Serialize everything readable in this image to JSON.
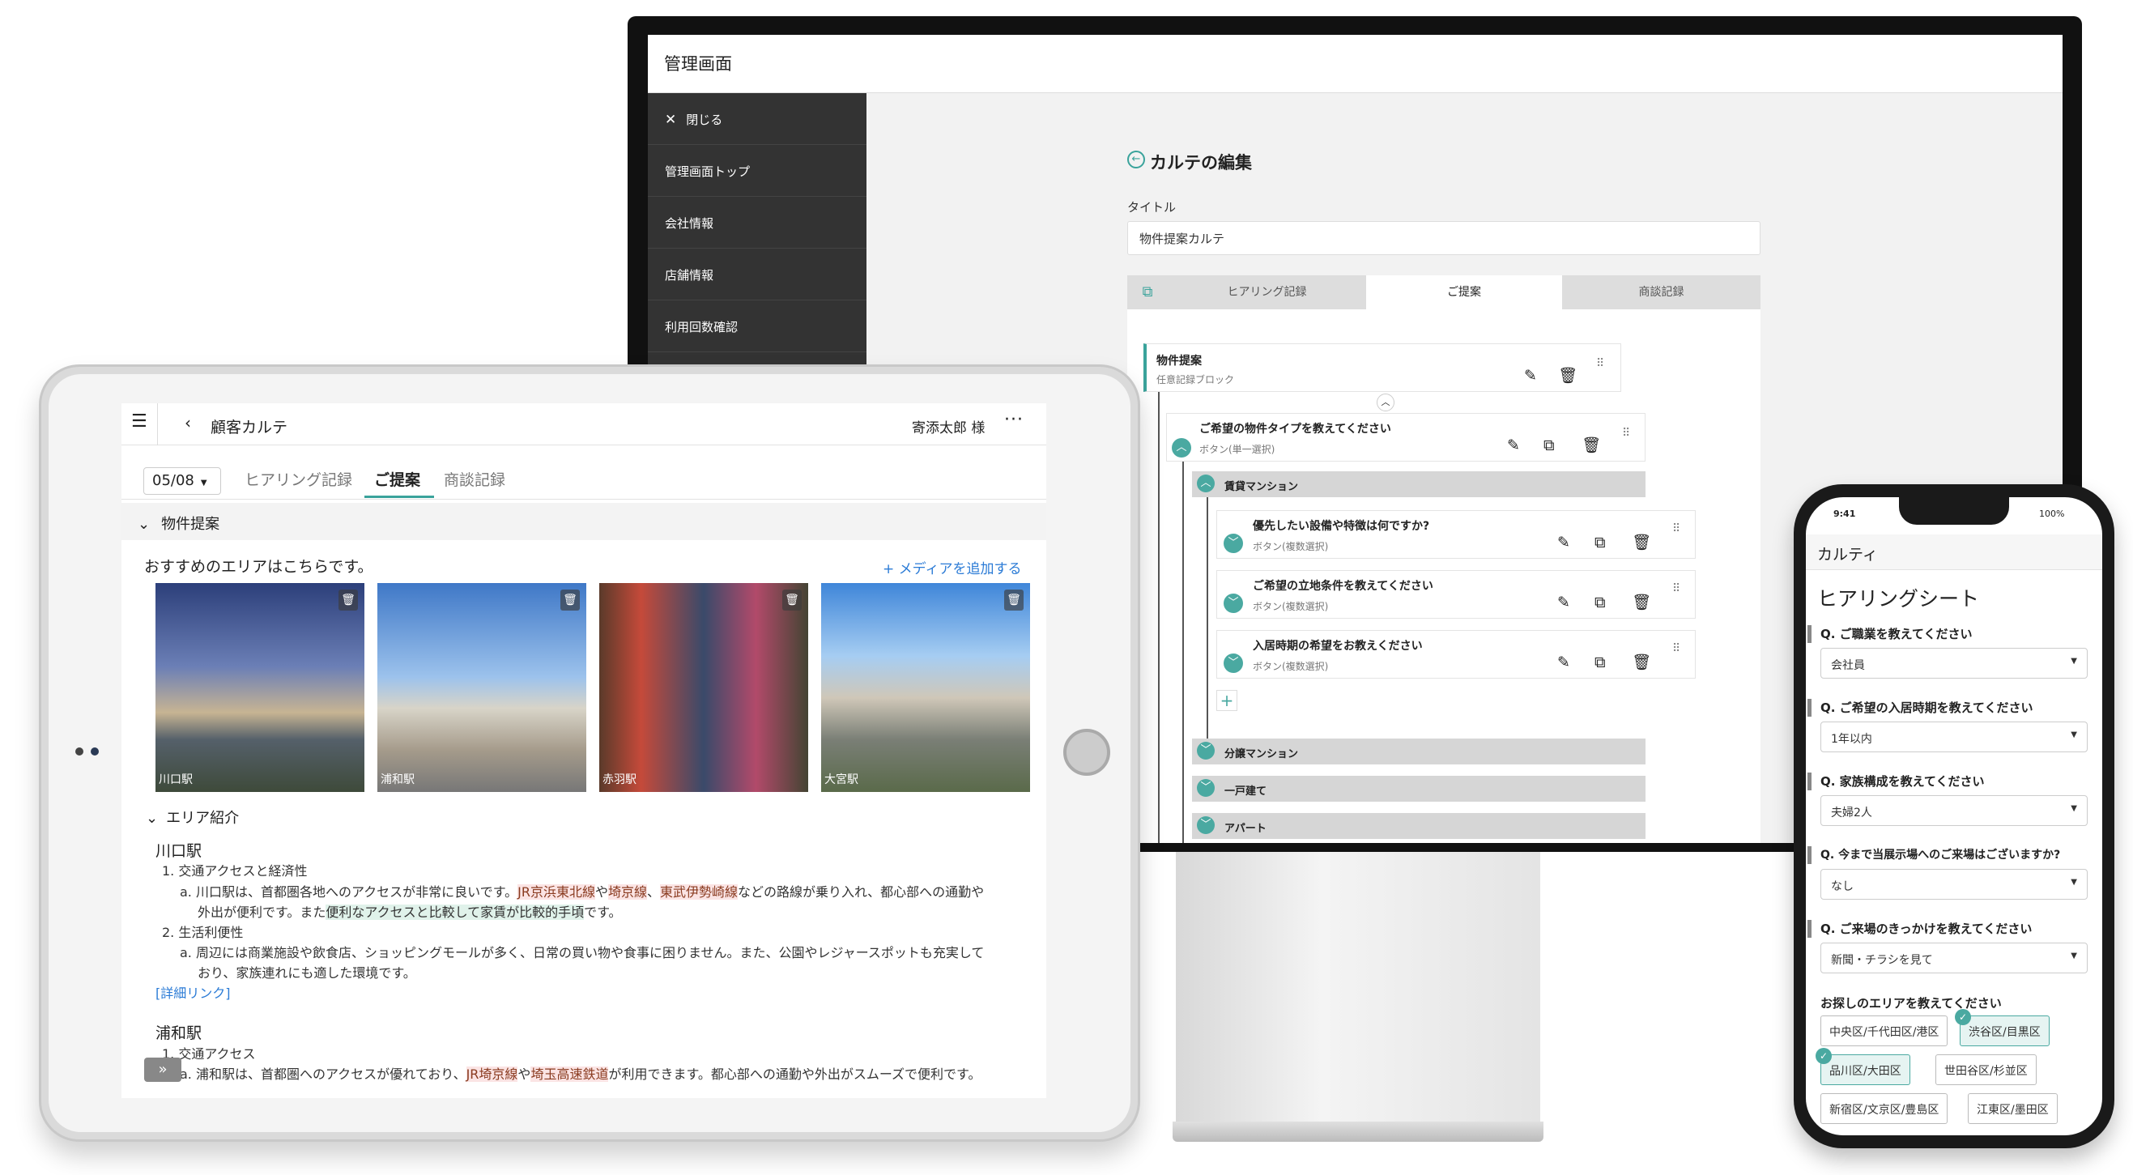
{
  "admin": {
    "window_title": "管理画面",
    "sidebar": {
      "close_label": "閉じる",
      "items": [
        "管理画面トップ",
        "会社情報",
        "店舗情報",
        "利用回数確認"
      ]
    },
    "page_title": "カルテの編集",
    "title_label": "タイトル",
    "title_value": "物件提案カルテ",
    "tabs": [
      "ヒアリング記録",
      "ご提案",
      "商談記録"
    ],
    "block": {
      "title": "物件提案",
      "subtitle": "任意記録ブロック"
    },
    "question": {
      "title": "ご希望の物件タイプを教えてください",
      "subtitle": "ボタン(単一選択)"
    },
    "groups": [
      "賃貸マンション",
      "分譲マンション",
      "一戸建て",
      "アパート"
    ],
    "sub_questions": [
      {
        "title": "優先したい設備や特徴は何ですか?",
        "subtitle": "ボタン(複数選択)"
      },
      {
        "title": "ご希望の立地条件を教えてください",
        "subtitle": "ボタン(複数選択)"
      },
      {
        "title": "入居時期の希望をお教えください",
        "subtitle": "ボタン(複数選択)"
      }
    ]
  },
  "tablet": {
    "header_title": "顧客カルテ",
    "customer_name": "寄添太郎 様",
    "date": "05/08",
    "tabs": [
      "ヒアリング記録",
      "ご提案",
      "商談記録"
    ],
    "section_title": "物件提案",
    "intro": "おすすめのエリアはこちらです。",
    "add_media": "+ メディアを追加する",
    "photos": [
      {
        "caption": "川口駅"
      },
      {
        "caption": "浦和駅"
      },
      {
        "caption": "赤羽駅"
      },
      {
        "caption": "大宮駅"
      }
    ],
    "area_heading": "エリア紹介",
    "station1": "川口駅",
    "s1_item1": "1. 交通アクセスと経済性",
    "s1_a_pre": "a. 川口駅は、首都圏各地へのアクセスが非常に良いです。",
    "s1_a_hl1": "JR京浜東北線",
    "s1_a_mid1": "や",
    "s1_a_hl2": "埼京線",
    "s1_a_mid2": "、",
    "s1_a_hl3": "東武伊勢崎線",
    "s1_a_post": "などの路線が乗り入れ、都心部への通勤や",
    "s1_a2_pre": "外出が便利です。また",
    "s1_a2_hl": "便利なアクセスと比較して家賃が比較的手頃",
    "s1_a2_post": "です。",
    "s1_item2": "2. 生活利便性",
    "s1_b1": "a. 周辺には商業施設や飲食店、ショッピングモールが多く、日常の買い物や食事に困りません。また、公園やレジャースポットも充実して",
    "s1_b2": "おり、家族連れにも適した環境です。",
    "detail_link": "[詳細リンク]",
    "station2": "浦和駅",
    "s2_item1": "1. 交通アクセス",
    "s2_a_pre": "a. 浦和駅は、首都圏へのアクセスが優れており、",
    "s2_a_hl1": "JR埼京線",
    "s2_a_mid": "や",
    "s2_a_hl2": "埼玉高速鉄道",
    "s2_a_post": "が利用できます。都心部への通勤や外出がスムーズで便利です。"
  },
  "phone": {
    "status_time": "9:41",
    "battery": "100%",
    "app_title": "カルティ",
    "sheet_title": "ヒアリングシート",
    "questions": [
      {
        "q": "Q. ご職業を教えてください",
        "value": "会社員"
      },
      {
        "q": "Q. ご希望の入居時期を教えてください",
        "value": "1年以内"
      },
      {
        "q": "Q. 家族構成を教えてください",
        "value": "夫婦2人"
      },
      {
        "q": "Q. 今まで当展示場へのご来場はございますか?",
        "value": "なし"
      },
      {
        "q": "Q. ご来場のきっかけを教えてください",
        "value": "新聞・チラシを見て"
      }
    ],
    "area_question": "お探しのエリアを教えてください",
    "areas": [
      {
        "label": "中央区/千代田区/港区",
        "selected": false
      },
      {
        "label": "渋谷区/目黒区",
        "selected": true
      },
      {
        "label": "品川区/大田区",
        "selected": true
      },
      {
        "label": "世田谷区/杉並区",
        "selected": false
      },
      {
        "label": "新宿区/文京区/豊島区",
        "selected": false
      },
      {
        "label": "江東区/墨田区",
        "selected": false
      }
    ]
  },
  "colors": {
    "accent": "#3aa39b",
    "sidebar": "#333333",
    "highlight_red": "#fbe4e4",
    "highlight_green": "#e0f2ea"
  }
}
